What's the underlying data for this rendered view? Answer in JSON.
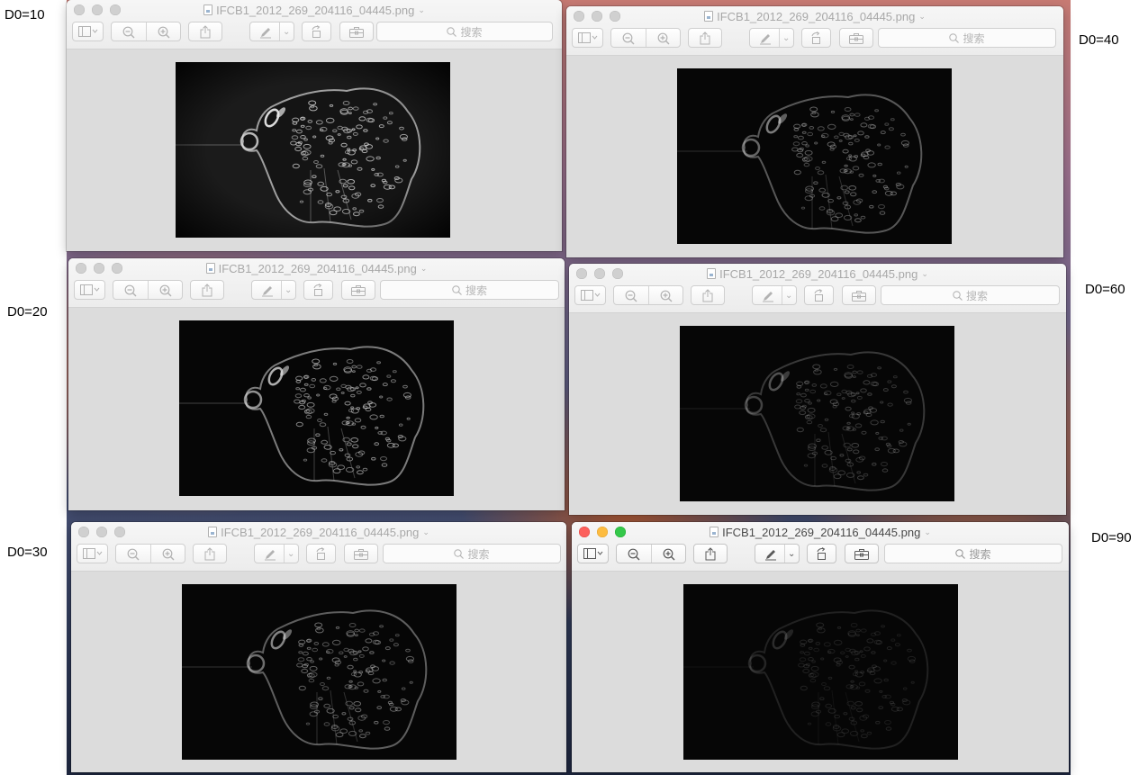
{
  "side_labels": [
    "D0=10",
    "D0=40",
    "D0=20",
    "D0=60",
    "D0=30",
    "D0=90"
  ],
  "windows": [
    {
      "filename": "IFCB1_2012_269_204116_04445.png",
      "search_placeholder": "搜索",
      "active": false
    },
    {
      "filename": "IFCB1_2012_269_204116_04445.png",
      "search_placeholder": "搜索",
      "active": false
    },
    {
      "filename": "IFCB1_2012_269_204116_04445.png",
      "search_placeholder": "搜索",
      "active": false
    },
    {
      "filename": "IFCB1_2012_269_204116_04445.png",
      "search_placeholder": "搜索",
      "active": false
    },
    {
      "filename": "IFCB1_2012_269_204116_04445.png",
      "search_placeholder": "搜索",
      "active": false
    },
    {
      "filename": "IFCB1_2012_269_204116_04445.png",
      "search_placeholder": "搜索",
      "active": true
    }
  ],
  "toolbar_icons": [
    "sidebar-icon",
    "zoom-out-icon",
    "zoom-in-icon",
    "share-icon",
    "markup-pen-icon",
    "rotate-icon",
    "toolbox-icon",
    "search-icon"
  ],
  "colors": {
    "close": "#fc605c",
    "minimize": "#fdbc40",
    "maximize": "#34c84a",
    "inactive_light": "#d0d0d0",
    "content_bg": "#dcdcdc",
    "image_bg": "#050505"
  }
}
